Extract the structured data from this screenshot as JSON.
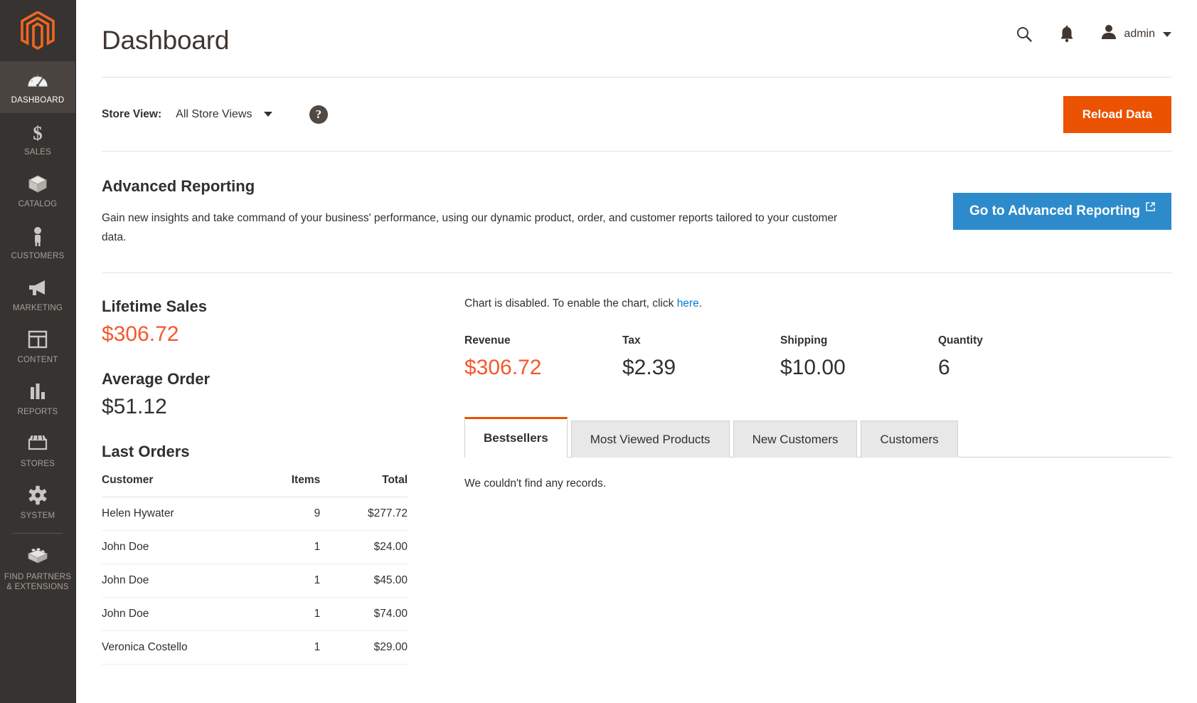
{
  "sidebar": {
    "logo": "magento-logo",
    "items": [
      {
        "label": "DASHBOARD",
        "icon": "dashboard-gauge-icon",
        "active": true
      },
      {
        "label": "SALES",
        "icon": "dollar-sign-icon",
        "active": false
      },
      {
        "label": "CATALOG",
        "icon": "box-icon",
        "active": false
      },
      {
        "label": "CUSTOMERS",
        "icon": "person-icon",
        "active": false
      },
      {
        "label": "MARKETING",
        "icon": "megaphone-icon",
        "active": false
      },
      {
        "label": "CONTENT",
        "icon": "layout-window-icon",
        "active": false
      },
      {
        "label": "REPORTS",
        "icon": "bar-chart-icon",
        "active": false
      },
      {
        "label": "STORES",
        "icon": "storefront-icon",
        "active": false
      },
      {
        "label": "SYSTEM",
        "icon": "gear-icon",
        "active": false
      }
    ],
    "partners": {
      "label_line1": "FIND PARTNERS",
      "label_line2": "& EXTENSIONS",
      "icon": "lego-brick-icon"
    }
  },
  "header": {
    "title": "Dashboard",
    "search_icon": "search-icon",
    "notifications_icon": "bell-icon",
    "account_icon": "user-avatar-icon",
    "account_name": "admin",
    "caret_icon": "chevron-down-icon"
  },
  "storeview": {
    "label": "Store View:",
    "value": "All Store Views",
    "help_icon": "question-mark-icon",
    "reload_label": "Reload Data"
  },
  "advanced_reporting": {
    "title": "Advanced Reporting",
    "description": "Gain new insights and take command of your business' performance, using our dynamic product, order, and customer reports tailored to your customer data.",
    "button_label": "Go to Advanced Reporting",
    "external_icon": "external-link-icon"
  },
  "stats": {
    "lifetime_sales_label": "Lifetime Sales",
    "lifetime_sales_value": "$306.72",
    "average_order_label": "Average Order",
    "average_order_value": "$51.12"
  },
  "last_orders": {
    "title": "Last Orders",
    "columns": [
      "Customer",
      "Items",
      "Total"
    ],
    "rows": [
      {
        "customer": "Helen Hywater",
        "items": "9",
        "total": "$277.72"
      },
      {
        "customer": "John Doe",
        "items": "1",
        "total": "$24.00"
      },
      {
        "customer": "John Doe",
        "items": "1",
        "total": "$45.00"
      },
      {
        "customer": "John Doe",
        "items": "1",
        "total": "$74.00"
      },
      {
        "customer": "Veronica Costello",
        "items": "1",
        "total": "$29.00"
      }
    ]
  },
  "chart_notice": {
    "text_before": "Chart is disabled. To enable the chart, click ",
    "link_label": "here",
    "text_after": "."
  },
  "metrics": [
    {
      "label": "Revenue",
      "value": "$306.72",
      "accent": true
    },
    {
      "label": "Tax",
      "value": "$2.39",
      "accent": false
    },
    {
      "label": "Shipping",
      "value": "$10.00",
      "accent": false
    },
    {
      "label": "Quantity",
      "value": "6",
      "accent": false
    }
  ],
  "tabs": {
    "items": [
      {
        "label": "Bestsellers",
        "active": true
      },
      {
        "label": "Most Viewed Products",
        "active": false
      },
      {
        "label": "New Customers",
        "active": false
      },
      {
        "label": "Customers",
        "active": false
      }
    ],
    "empty_message": "We couldn't find any records."
  },
  "colors": {
    "brand_orange": "#eb5202",
    "accent_red": "#f3582c",
    "link_blue": "#007bdb",
    "button_blue": "#2e8bcb",
    "sidebar_bg": "#373330",
    "sidebar_active": "#494440"
  }
}
